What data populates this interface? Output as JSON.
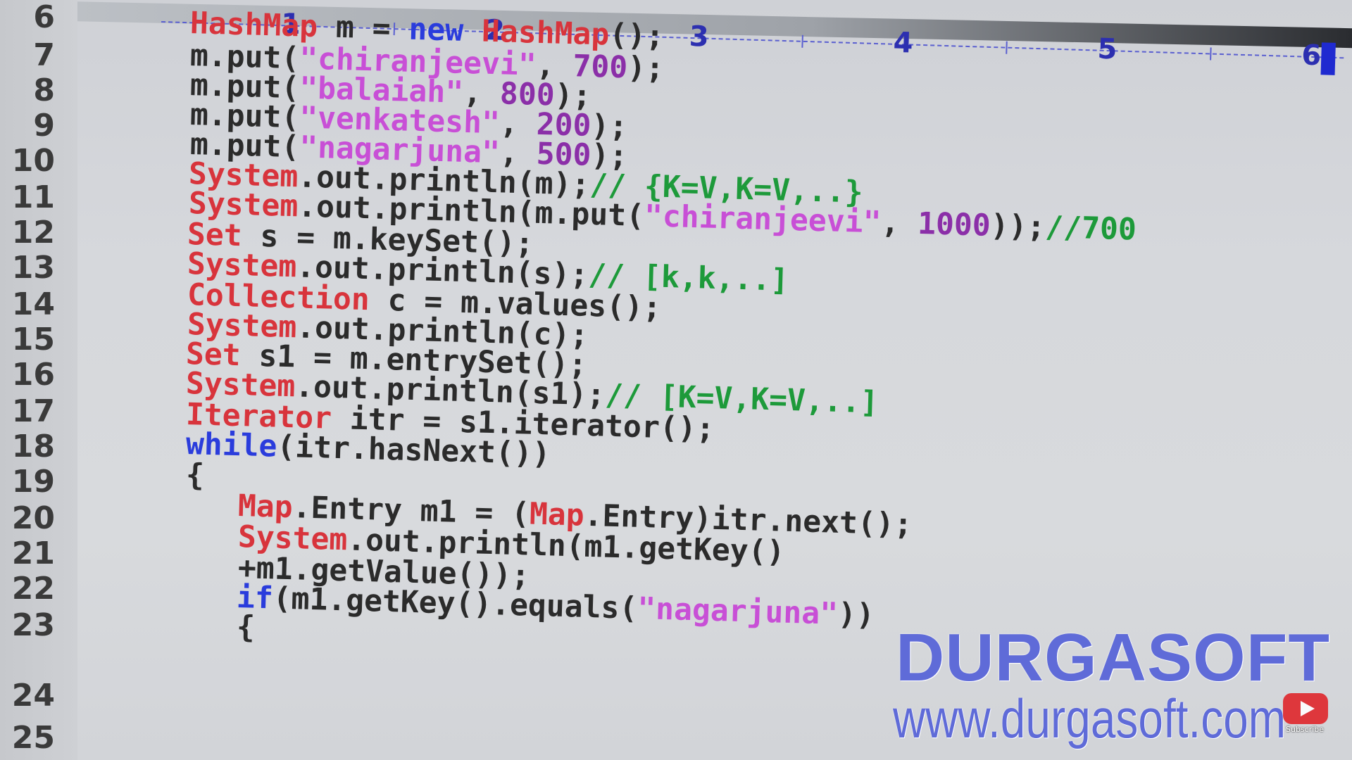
{
  "ruler": {
    "numbers": [
      "1",
      "2",
      "3",
      "4",
      "5",
      "6"
    ]
  },
  "editor": {
    "lines": [
      {
        "n": "6",
        "tokens": [
          [
            "type",
            "HashMap"
          ],
          [
            "plain",
            " m = "
          ],
          [
            "kw",
            "new"
          ],
          [
            "plain",
            " "
          ],
          [
            "type",
            "HashMap"
          ],
          [
            "plain",
            "();"
          ]
        ]
      },
      {
        "n": "7",
        "tokens": [
          [
            "plain",
            "m.put("
          ],
          [
            "str",
            "\"chiranjeevi\""
          ],
          [
            "plain",
            ", "
          ],
          [
            "num",
            "700"
          ],
          [
            "plain",
            ");"
          ]
        ]
      },
      {
        "n": "8",
        "tokens": [
          [
            "plain",
            "m.put("
          ],
          [
            "str",
            "\"balaiah\""
          ],
          [
            "plain",
            ", "
          ],
          [
            "num",
            "800"
          ],
          [
            "plain",
            ");"
          ]
        ]
      },
      {
        "n": "9",
        "tokens": [
          [
            "plain",
            "m.put("
          ],
          [
            "str",
            "\"venkatesh\""
          ],
          [
            "plain",
            ", "
          ],
          [
            "num",
            "200"
          ],
          [
            "plain",
            ");"
          ]
        ]
      },
      {
        "n": "10",
        "tokens": [
          [
            "plain",
            "m.put("
          ],
          [
            "str",
            "\"nagarjuna\""
          ],
          [
            "plain",
            ", "
          ],
          [
            "num",
            "500"
          ],
          [
            "plain",
            ");"
          ]
        ]
      },
      {
        "n": "11",
        "tokens": [
          [
            "type",
            "System"
          ],
          [
            "plain",
            ".out.println(m);"
          ],
          [
            "cmt",
            "// {K=V,K=V,..}"
          ]
        ]
      },
      {
        "n": "12",
        "tokens": [
          [
            "type",
            "System"
          ],
          [
            "plain",
            ".out.println(m.put("
          ],
          [
            "str",
            "\"chiranjeevi\""
          ],
          [
            "plain",
            ", "
          ],
          [
            "num",
            "1000"
          ],
          [
            "plain",
            "));"
          ],
          [
            "cmt",
            "//700"
          ]
        ]
      },
      {
        "n": "13",
        "tokens": [
          [
            "type",
            "Set"
          ],
          [
            "plain",
            " s = m.keySet();"
          ]
        ]
      },
      {
        "n": "14",
        "tokens": [
          [
            "type",
            "System"
          ],
          [
            "plain",
            ".out.println(s);"
          ],
          [
            "cmt",
            "// [k,k,..]"
          ]
        ]
      },
      {
        "n": "15",
        "tokens": [
          [
            "type",
            "Collection"
          ],
          [
            "plain",
            " c = m.values();"
          ]
        ]
      },
      {
        "n": "16",
        "tokens": [
          [
            "type",
            "System"
          ],
          [
            "plain",
            ".out.println(c);"
          ]
        ]
      },
      {
        "n": "17",
        "tokens": [
          [
            "type",
            "Set"
          ],
          [
            "plain",
            " s1 = m.entrySet();"
          ]
        ]
      },
      {
        "n": "18",
        "tokens": [
          [
            "type",
            "System"
          ],
          [
            "plain",
            ".out.println(s1);"
          ],
          [
            "cmt",
            "// [K=V,K=V,..]"
          ]
        ]
      },
      {
        "n": "19",
        "tokens": [
          [
            "type",
            "Iterator"
          ],
          [
            "plain",
            " itr = s1.iterator();"
          ]
        ]
      },
      {
        "n": "20",
        "tokens": [
          [
            "kw",
            "while"
          ],
          [
            "plain",
            "(itr.hasNext())"
          ]
        ]
      },
      {
        "n": "21",
        "tokens": [
          [
            "plain",
            "{"
          ]
        ]
      },
      {
        "n": "22",
        "tokens": [
          [
            "type",
            "Map"
          ],
          [
            "plain",
            ".Entry m1 = ("
          ],
          [
            "type",
            "Map"
          ],
          [
            "plain",
            ".Entry)itr.next();"
          ]
        ]
      },
      {
        "n": "23",
        "tokens": [
          [
            "type",
            "System"
          ],
          [
            "plain",
            ".out.println(m1.getKey()"
          ]
        ]
      },
      {
        "n": "",
        "tokens": [
          [
            "plain",
            "+m1.getValue());"
          ]
        ]
      },
      {
        "n": "24",
        "tokens": [
          [
            "kw",
            "if"
          ],
          [
            "plain",
            "(m1.getKey().equals("
          ],
          [
            "str",
            "\"nagarjuna\""
          ],
          [
            "plain",
            "))"
          ]
        ]
      },
      {
        "n": "25",
        "tokens": [
          [
            "plain",
            "{"
          ]
        ]
      }
    ]
  },
  "watermark": {
    "title": "DURGASOFT",
    "url": "www.durgasoft.com"
  },
  "youtube": {
    "label": "Subscribe"
  },
  "colors": {
    "type": "#d8343c",
    "keyword": "#2a3cdc",
    "string": "#c84fd6",
    "number": "#8b2fa8",
    "comment": "#1d9a3a",
    "watermark": "#5f6bd8"
  }
}
